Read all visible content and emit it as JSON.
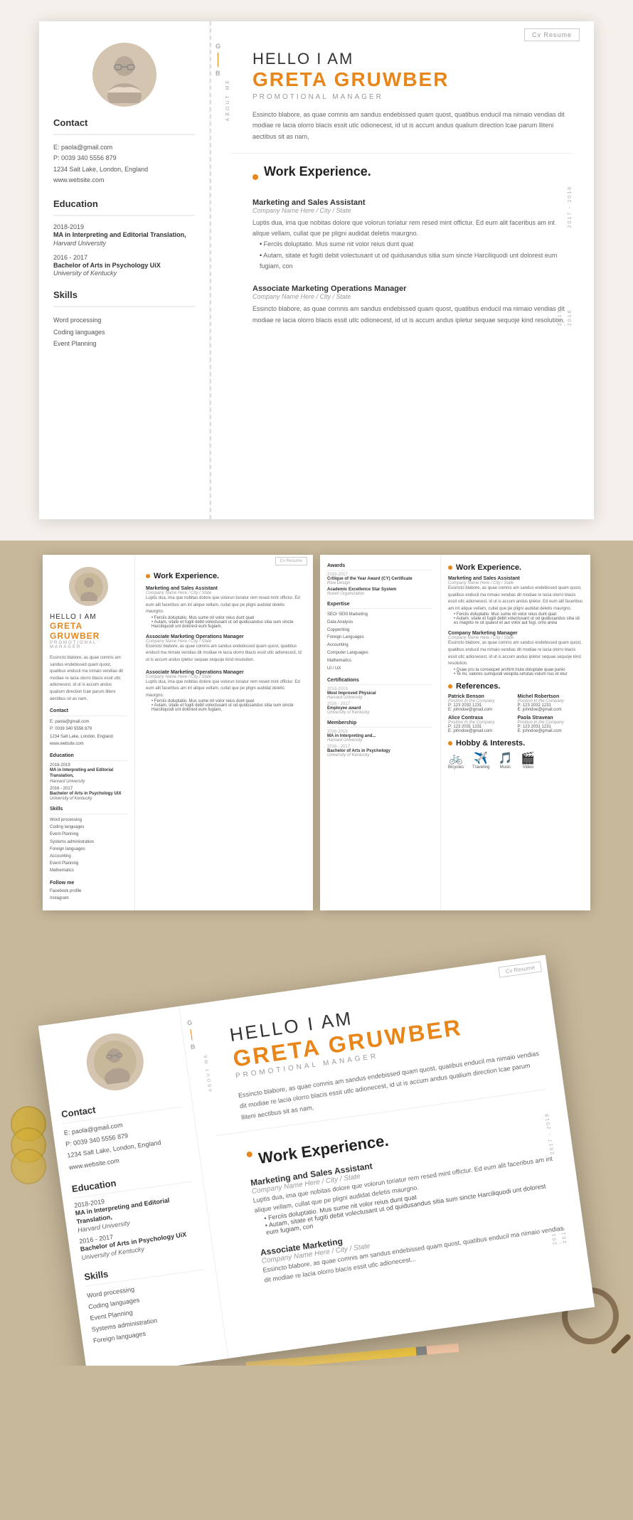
{
  "cv": {
    "badge": "Cv Resume",
    "greeting": "HELLO I AM",
    "name": "GRETA GRUWBER",
    "title": "PROMOTIONAL MANAGER",
    "bio": "Essincto blabore, as quae comnis am sandus endebissed quam quost, quatibus enducil ma nimaio vendias dit modiae re lacia olorro blacis essit utlc odionecest, id ut is accum andus qualium direction lcae parum lliteni aectibus sit as nam,",
    "contact": {
      "title": "Contact",
      "email": "E: paola@gmail.com",
      "phone": "P: 0039 340 5556 879",
      "address": "1234 Salt Lake, London, England",
      "website": "www.website.com"
    },
    "education": {
      "title": "Education",
      "items": [
        {
          "years": "2018-2019",
          "degree": "MA in Interpreting and Editorial Translation,",
          "university": "Harvard University"
        },
        {
          "years": "2016 - 2017",
          "degree": "Bachelor of Arts in Psychology UiX",
          "university": "University of Kentucky"
        }
      ]
    },
    "skills": {
      "title": "Skills",
      "items": [
        "Word processing",
        "Coding languages",
        "Event Planning"
      ]
    },
    "work_experience": {
      "title": "Work Experience.",
      "jobs": [
        {
          "role": "Marketing and Sales Assistant",
          "company": "Company Name Here / City / State",
          "year_range": "2017 - 2018",
          "description": "Luptis dua, ima que nobitas dolore que volorun toriatur rem resed mint offictur. Ed eum alit faceribus am int alique vellam, cullat que pe pligni audidat deletis maurgno.",
          "bullets": [
            "Ferciis doluptatio. Mus sume nit volor reius dunt quat",
            "Autam, sitate et fugiti debit volectusant ut od quidusandus sitia sum sincte Harciliquodi unt dolorest eum fugiam, con"
          ]
        },
        {
          "role": "Associate Marketing Operations Manager",
          "company": "Company Name Here / City / State",
          "year_range": "2017 - 2016",
          "description": "Essincto blabore, as quae comnis am sandus endebissed quam quost, quatibus enducil ma nimaio vendias dit modiae re lacia olorro blacis essit utlc odionecest, id ut is accum andus ipletur sequae sequoje kind resolution."
        }
      ]
    },
    "about_me_label": "ABOUT ME",
    "gb_label": [
      "G",
      "B"
    ]
  },
  "spread": {
    "page1": {
      "badge": "Cv Resume",
      "greeting": "HELLO I AM",
      "name": "GRETA GRUWBER",
      "title": "PROMOTIONAL MANAGER",
      "bio": "Essincto blabore, as quae comnis am sandus endebissed quam quost, quatibus enducil ma nimaio vendias dit modiae re lacia olorro blacis essit utlc adionecest, id ut is accum andus qualium direction lcae parum lliteni aectibus sit as nam,",
      "work_title": "Work Experience.",
      "jobs": [
        {
          "role": "Marketing and Sales Assistant",
          "company": "Company Name Here / City / State",
          "description": "Luptis dua, ima que nobitas dolore que volorun toriatur rem resed mint offictur. Ed eum alit faceribus am int alique vellam, cullat que pe pligni audidat deletis maurgno.",
          "bullets": [
            "Ferciis doluptatio. Mus sume nit volor reius dunt quat",
            "Autam, sitate et fugiti debit volectusant ut od quidusandus sitia sum sincte Harciliquodi unt dolorest eum fugiam,"
          ]
        },
        {
          "role": "Associate Marketing Operations Manager",
          "company": "Company Name Here / City / State",
          "description": "Essincto blabore, as quae comnis am sandus endebissed quam quost, quatibus enducil ma nimaio vendias dit modiae re lacia olorro blacis essit utlc adionecest, id ut is accum andus ipletur sequae sequoje kind resolution."
        },
        {
          "role": "Associate Marketing Operations Manager",
          "company": "Company Name Here / City / State",
          "description": "Luptis dua, ima que nobitas dolore que volorun toriatur rem resed mint offictur. Ed eum alit faceribus am int alique vellam, cullat que pe pligni audidat deletis maurgno.",
          "bullets": [
            "Ferciis doluptatio. Mus sume nit volor reius dunt quat",
            "Autam, sitate et fugiti debit volectusant ut od quidusandus sitia sum sincte Harciliquodi unt dolorest eum fugiam,"
          ]
        }
      ],
      "contact": {
        "title": "Contact",
        "email": "E: paola@gmail.com",
        "phone": "P: 0039 340 5556 879",
        "address": "1234 Salt Lake, London, England",
        "website": "www.website.com"
      },
      "education": {
        "title": "Education",
        "items": [
          {
            "years": "2018-2019",
            "degree": "MA in Interpreting and Editorial Translation,",
            "uni": "Harvard University"
          },
          {
            "years": "2016 - 2017",
            "degree": "Bachelor of Arts in Psychology UiX",
            "uni": "University of Kentucky"
          }
        ]
      },
      "skills": {
        "title": "Skills",
        "items": [
          "Word processing",
          "Coding languages",
          "Event Planning",
          "Systems administration",
          "Foreign languages",
          "Accounting",
          "Event Planning",
          "Mathematics"
        ]
      },
      "follow_me": {
        "title": "Follow me",
        "items": [
          "Facebook profile",
          "Instagram"
        ]
      }
    },
    "page2": {
      "awards": {
        "title": "Awards",
        "items": [
          {
            "year": "2019-2017",
            "name": "Critique of the Year Award (CY) Certificate",
            "org": "Riva Design"
          },
          {
            "year": "",
            "name": "Academic Excellence Star System",
            "org": "Novell Organization"
          }
        ]
      },
      "expertise": {
        "title": "Expertise",
        "items": [
          "SEO/ SEM Marketing",
          "Data Analysis",
          "Copywriting",
          "Foreign Languages",
          "Accounting",
          "Computer Languages",
          "Mathematics",
          "UI / UX"
        ]
      },
      "certifications": {
        "title": "Certifications",
        "items": [
          {
            "year": "2018-2019",
            "name": "Most Improved Physical",
            "org": "Harvard University"
          },
          {
            "year": "2016 - 2017",
            "name": "Employee award",
            "org": "University of Kentucky"
          }
        ]
      },
      "membership": {
        "title": "Membership",
        "items": [
          {
            "year": "2016-2019",
            "name": "MA in Interpreting and...",
            "org": "Harvard University"
          },
          {
            "year": "2016 - 2017",
            "name": "Bachelor of Arts in Psychology",
            "org": "University of Kentucky"
          }
        ]
      },
      "work_experience": {
        "title": "Work Experience.",
        "jobs": [
          {
            "role": "Marketing and Sales Assistant",
            "company": "Company Name Here / City / State",
            "description": "Essincto blabore, as quae comnis am sandus endebissed quam quost, quatibus enducil ma nimaio vendias dit modiae re lacia olorro blacis essit utlc adionecest, id ut is accum andus ipletur. Ed eum alit faceribus am int alique vellam, cullat que pe pligni audidat deletis maurgno.",
            "bullets": [
              "Ferciis doluptatio. Mus sume nit volor reius dunt quat",
              "Autam, sitate et fugiti debit volectusant ut od quidusandus sitia sit es magnto re sit quaest et aut volor aut fugi, omo arela"
            ]
          },
          {
            "role": "Company Marketing Manager",
            "company": "Company Name Here / City / State",
            "description": "Essincto blabore, as quae comnis am sandus endebissed quam quost, quatibus enducil ma nimaio vendias dit modiae re lacia olorro blacis essit utlc adionecest, id ut is accum andus ipletur sequae sequoje kind resolution.",
            "bullets": [
              "Quae pru ta consequet archint inula doluptate quae panio",
              "Te mi, valores sumquodi velupita iurtutas volum nus et etur"
            ]
          }
        ]
      },
      "references": {
        "title": "References.",
        "people": [
          {
            "name": "Patrick Benson",
            "position": "Position In the Company",
            "phone": "P: 123 2032 1231",
            "email": "E: johndoe@gmail.com"
          },
          {
            "name": "Michel Robertson",
            "position": "Position In the Company",
            "phone": "P: 123 2032 1231",
            "email": "E: johndoe@gmail.com"
          },
          {
            "name": "Alice Contrasa",
            "position": "Position In the Company",
            "phone": "P: 123 2031 1231",
            "email": "E: johndoe@gmail.com"
          },
          {
            "name": "Paola Stravean",
            "position": "Position In the Company",
            "phone": "P: 123 2031 1231",
            "email": "E: johndoe@gmail.com"
          }
        ]
      },
      "hobbies": {
        "title": "Hobby & Interests.",
        "items": [
          {
            "icon": "🚲",
            "label": "Bicycles"
          },
          {
            "icon": "✈️",
            "label": "Traveling"
          },
          {
            "icon": "🎵",
            "label": "Music"
          },
          {
            "icon": "🎬",
            "label": "Video"
          }
        ]
      }
    }
  },
  "tilted": {
    "badge": "Cv Resume",
    "greeting": "HELLO I AM",
    "name": "GRETA GRUWBER",
    "title": "PROMOTIONAL MANAGER",
    "bio": "Essincto blabore, as quae comnis am sandus endebissed quam quost, quatibus enducil ma nimaio vendias dit modiae re lacia olorro blacis essit utlc adionecest, id ut is accum andus qualium direction lcae parum lliteni aectibus sit as nam,",
    "work_title": "Work Experience.",
    "contact_title": "Contact",
    "contact_email": "E: paola@gmail.com",
    "contact_phone": "P: 0039 340 5556 879",
    "contact_address": "1234 Salt Lake, London, England",
    "contact_website": "www.website.com",
    "edu_title": "Education",
    "edu_items": [
      {
        "years": "2018-2019",
        "degree": "MA in Interpreting and Editorial Translation,",
        "uni": "Harvard University"
      },
      {
        "years": "2016 - 2017",
        "degree": "Bachelor of Arts in Psychology UiX",
        "uni": "University of Kentucky"
      }
    ],
    "skill_items": [
      "Word processing",
      "Coding languages",
      "Event Planning",
      "Systems administration",
      "Foreign languages"
    ],
    "jobs": [
      {
        "role": "Marketing and Sales Assistant",
        "company": "Company Name Here / City / State",
        "description": "Luptis dua, ima que nobitas dolore que volorun toriatur rem resed mint offictur. Ed eum alit faceribus am int alique vellam, cullat que pe pligni audidat deletis maurgno.",
        "bullets": [
          "Ferciis doluptatio. Mus sume nit volor reius dunt quat",
          "Autam, sitate et fugiti debit volectusant ut od quidusandus sitia sum sincte Harciliquodi unt dolorest eum fugiam, con"
        ]
      },
      {
        "role": "Associate Marketing",
        "company": "Company Name Here / City / State",
        "description": "Essincto blabore, as quae comnis am sandus endebissed quam quost, quatibus enducil ma nimaio vendias dit modiae re lacia olorro blacis essit utlc adionecest..."
      }
    ],
    "year_2017_2018": "2017 - 2018",
    "year_2017_2016": "2017 - 2016",
    "about_me": "ABOUT ME"
  },
  "colors": {
    "orange": "#e8861a",
    "bg_warm": "#c8b89a",
    "text_dark": "#333333",
    "text_medium": "#666666",
    "text_light": "#999999"
  }
}
